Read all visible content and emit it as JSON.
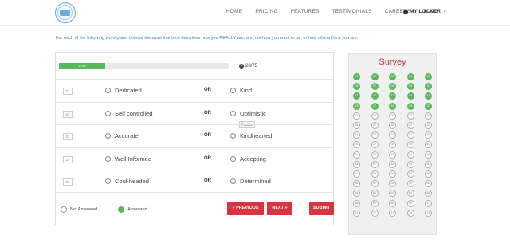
{
  "nav": {
    "items": [
      "HOME",
      "PRICING",
      "FEATURES",
      "TESTIMONIALS",
      "CAREERS",
      "BLOG"
    ],
    "locker_label": "MY LOCKER"
  },
  "instruction": "For each of the following word-pairs, choose the word that best describes how you REALLY are, and not how you want to be, or how others think you are.",
  "progress": {
    "percent": 27,
    "label": "27%",
    "count": "20/75"
  },
  "questions": [
    {
      "num": "21",
      "a": "Dedicated",
      "b": "Kind"
    },
    {
      "num": "22",
      "a": "Self controlled",
      "b": "Optimistic"
    },
    {
      "num": "23",
      "a": "Accurate",
      "b": "Kindhearted"
    },
    {
      "num": "24",
      "a": "Well Informed",
      "b": "Accepting"
    },
    {
      "num": "25",
      "a": "Cool-headed",
      "b": "Determined"
    }
  ],
  "or_label": "OR",
  "tooltip": "Positive",
  "legend": {
    "not_answered": "Not Answered",
    "answered": "Answered"
  },
  "buttons": {
    "previous": "« PREVIOUS",
    "next": "NEXT »",
    "submit": "SUBMIT"
  },
  "survey": {
    "title": "Survey",
    "answered_count": 20,
    "total": 75
  },
  "colors": {
    "accent": "#d9343f",
    "answered": "#5cb85c",
    "link": "#3a7fc6"
  }
}
